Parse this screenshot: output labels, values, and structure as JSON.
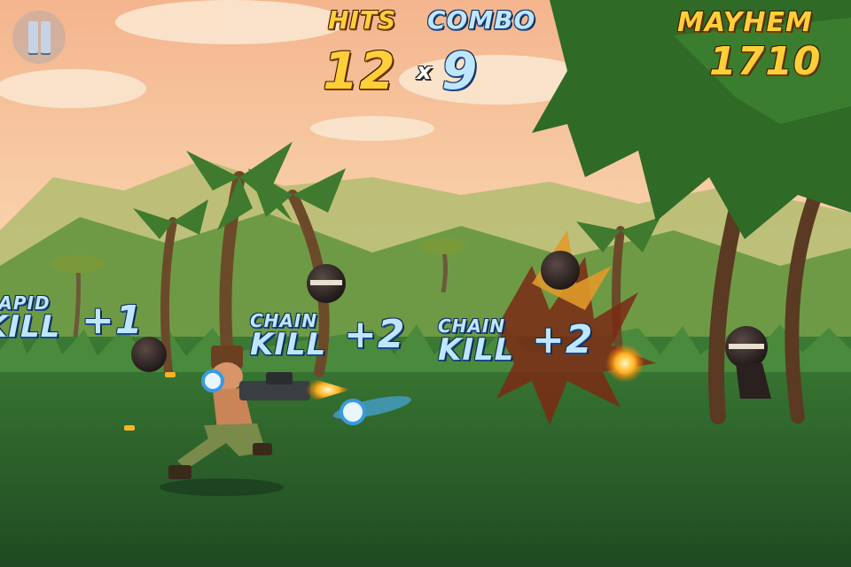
{
  "hud": {
    "hits_label": "HITS",
    "combo_label": "COMBO",
    "hits_value": "12",
    "multiplier_sign": "x",
    "combo_value": "9",
    "mayhem_label": "MAYHEM",
    "mayhem_value": "1710"
  },
  "popups": [
    {
      "line1": "RAPID",
      "line2": "KILL",
      "bonus": "+1"
    },
    {
      "line1": "CHAIN",
      "line2": "KILL",
      "bonus": "+2"
    },
    {
      "line1": "CHAIN",
      "line2": "KILL",
      "bonus": "+2"
    }
  ],
  "controls": {
    "pause": "pause-icon"
  },
  "colors": {
    "sky": "#f6c9a0",
    "hud_gold": "#ffcf3a",
    "hud_blue": "#bfe6ff",
    "grass": "#2f6a2c"
  }
}
